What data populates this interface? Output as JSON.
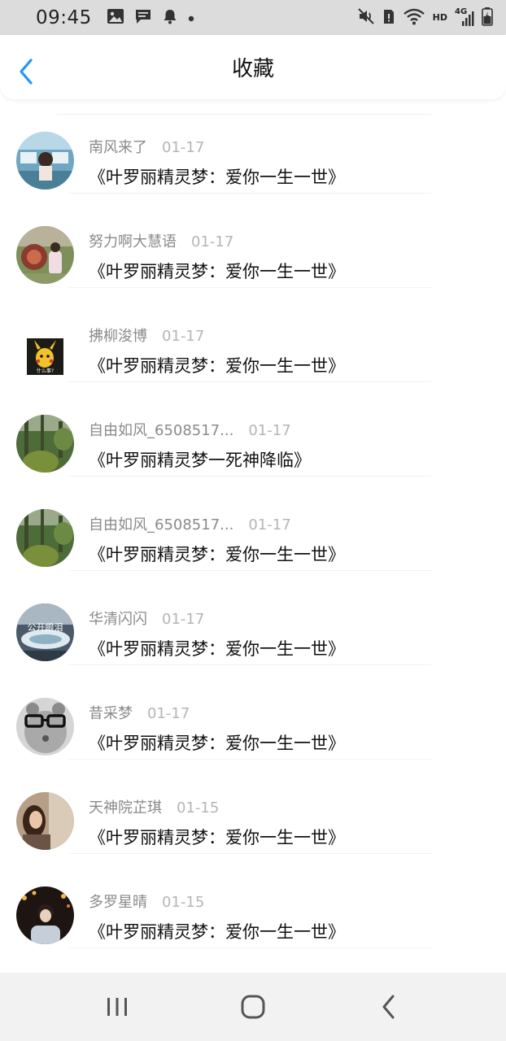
{
  "status_bar": {
    "time": "09:45",
    "left_icons": [
      "image-icon",
      "message-icon",
      "bell-icon",
      "dot-icon"
    ],
    "right_icons": [
      "mute-icon",
      "sim-alert-icon",
      "wifi-icon",
      "hd-icon",
      "signal-4g-icon",
      "battery-icon"
    ],
    "hd_label": "HD",
    "network_label": "4G"
  },
  "header": {
    "title": "收藏",
    "back_icon": "chevron-left-icon",
    "accent_color": "#2196f3"
  },
  "favorites": [
    {
      "user": "南风来了",
      "date": "01-17",
      "title": "《叶罗丽精灵梦：爱你一生一世》",
      "avatar": "anime-train"
    },
    {
      "user": "努力啊大慧语",
      "date": "01-17",
      "title": "《叶罗丽精灵梦：爱你一生一世》",
      "avatar": "girl-garden"
    },
    {
      "user": "拂柳浚博",
      "date": "01-17",
      "title": "《叶罗丽精灵梦：爱你一生一世》",
      "avatar": "pikachu",
      "avatar_text": "什么事?"
    },
    {
      "user": "自由如风_6508517...",
      "date": "01-17",
      "title": "《叶罗丽精灵梦一死神降临》",
      "avatar": "forest"
    },
    {
      "user": "自由如风_6508517...",
      "date": "01-17",
      "title": "《叶罗丽精灵梦：爱你一生一世》",
      "avatar": "forest"
    },
    {
      "user": "华清闪闪",
      "date": "01-17",
      "title": "《叶罗丽精灵梦：爱你一生一世》",
      "avatar": "lake",
      "avatar_text": "公开眼泪"
    },
    {
      "user": "昔采梦",
      "date": "01-17",
      "title": "《叶罗丽精灵梦：爱你一生一世》",
      "avatar": "glasses-baby"
    },
    {
      "user": "天神院芷琪",
      "date": "01-15",
      "title": "《叶罗丽精灵梦：爱你一生一世》",
      "avatar": "girl-room"
    },
    {
      "user": "多罗星晴",
      "date": "01-15",
      "title": "《叶罗丽精灵梦：爱你一生一世》",
      "avatar": "night-boy"
    }
  ],
  "bottom_nav": {
    "items": [
      "recent-apps-icon",
      "home-icon",
      "back-icon"
    ]
  }
}
